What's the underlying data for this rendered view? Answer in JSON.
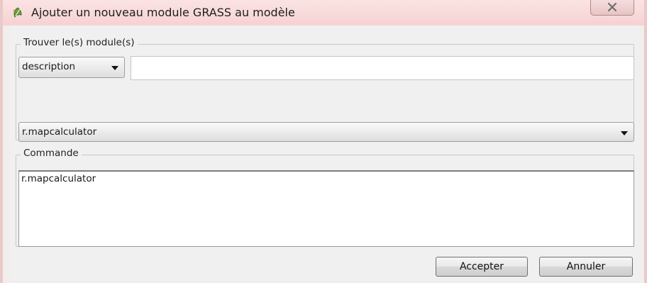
{
  "window": {
    "title": "Ajouter un nouveau module GRASS au modèle"
  },
  "find_group": {
    "legend": "Trouver le(s) module(s)",
    "filter_combo_value": "description",
    "search_value": ""
  },
  "module_combo": {
    "value": "r.mapcalculator"
  },
  "command_group": {
    "legend": "Commande",
    "text": "r.mapcalculator"
  },
  "buttons": {
    "accept": "Accepter",
    "cancel": "Annuler"
  },
  "icons": {
    "title": "grass-leaf-icon",
    "close": "close-icon"
  },
  "colors": {
    "titlebar": "#f5d2d2",
    "window_border": "#e9c9c9"
  }
}
